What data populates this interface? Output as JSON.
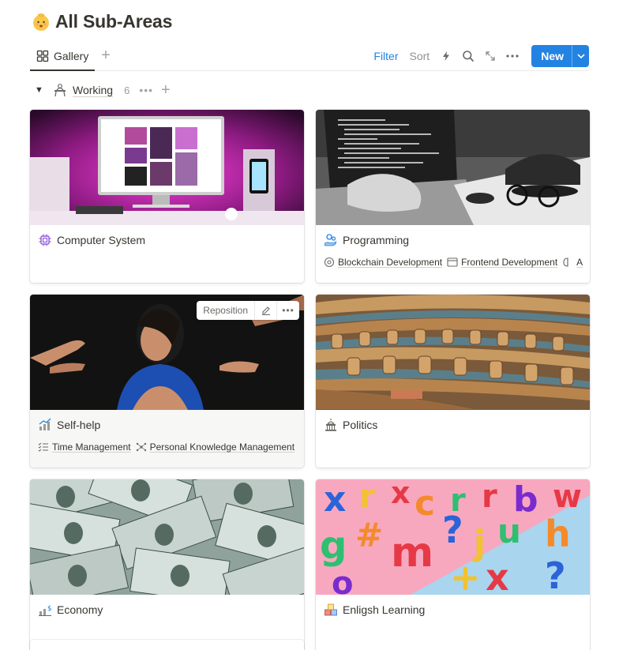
{
  "page": {
    "title": "All Sub-Areas",
    "icon": "baby-face-emoji"
  },
  "view": {
    "tab_label": "Gallery",
    "toolbar": {
      "filter": "Filter",
      "sort": "Sort",
      "new_label": "New"
    }
  },
  "group": {
    "name": "Working",
    "count": "6"
  },
  "cards": [
    {
      "title": "Computer System",
      "icon": "chip-icon",
      "cover": "computer-desk-pink-light",
      "tags": []
    },
    {
      "title": "Programming",
      "icon": "hand-gears-icon",
      "cover": "laptop-coding-bw",
      "tags": [
        {
          "label": "Blockchain Development",
          "icon": "blockchain-icon"
        },
        {
          "label": "Frontend Development",
          "icon": "browser-window-icon"
        },
        {
          "label": "A",
          "icon": "brain-icon"
        }
      ]
    },
    {
      "title": "Self-help",
      "icon": "growth-chart-icon",
      "cover": "woman-surrounded-hands",
      "tags": [
        {
          "label": "Time Management",
          "icon": "checklist-icon"
        },
        {
          "label": "Personal Knowledge Management",
          "icon": "network-icon"
        }
      ],
      "cover_actions": {
        "reposition": "Reposition"
      }
    },
    {
      "title": "Politics",
      "icon": "capitol-icon",
      "cover": "parliament-chamber",
      "tags": []
    },
    {
      "title": "Economy",
      "icon": "dollar-chart-icon",
      "cover": "dollar-bills",
      "tags": []
    },
    {
      "title": "Enligsh Learning",
      "icon": "alphabet-blocks-icon",
      "cover": "colorful-letters",
      "tags": []
    }
  ],
  "colors": {
    "accent": "#2383e2",
    "text": "#37352f",
    "muted": "#91918e"
  }
}
